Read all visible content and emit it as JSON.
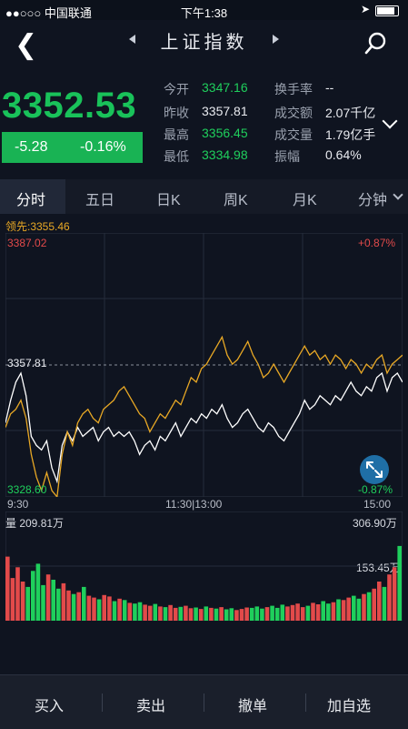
{
  "status_bar": {
    "carrier": "●●○○○ 中国联通",
    "time": "下午1:38",
    "arrow": "➤"
  },
  "header": {
    "title": "上证指数",
    "subtitle": ""
  },
  "quote": {
    "price": "3352.53",
    "change": "-5.28",
    "change_pct": "-0.16%",
    "stats": [
      {
        "label": "今开",
        "value": "3347.16",
        "color": "green"
      },
      {
        "label": "换手率",
        "value": "--",
        "color": "white"
      },
      {
        "label": "昨收",
        "value": "3357.81",
        "color": "white"
      },
      {
        "label": "成交额",
        "value": "2.07千亿",
        "color": "white"
      },
      {
        "label": "最高",
        "value": "3356.45",
        "color": "green"
      },
      {
        "label": "成交量",
        "value": "1.79亿手",
        "color": "white"
      },
      {
        "label": "最低",
        "value": "3334.98",
        "color": "green"
      },
      {
        "label": "振幅",
        "value": "0.64%",
        "color": "white"
      }
    ]
  },
  "tabs": [
    "分时",
    "五日",
    "日K",
    "周K",
    "月K",
    "分钟"
  ],
  "chart": {
    "lead_label": "领先:3355.46",
    "y_top": "3387.02",
    "y_top_pct": "+0.87%",
    "y_mid": "3357.81",
    "y_bottom": "3328.60",
    "y_bottom_pct": "-0.87%",
    "t_start": "9:30",
    "t_mid": "11:30|13:00",
    "t_end": "15:00",
    "vol_label": "量 209.81万",
    "vol_max": "306.90万",
    "vol_mid": "153.45万"
  },
  "chart_data": {
    "type": "line",
    "y_range": [
      3328.6,
      3387.02
    ],
    "prev_close": 3357.81,
    "series": [
      {
        "color": "#ffffff",
        "values": [
          3345,
          3350,
          3354,
          3356,
          3351,
          3342,
          3340,
          3339,
          3341,
          3335,
          3332,
          3340,
          3343,
          3341,
          3344,
          3342,
          3343,
          3344,
          3341,
          3343,
          3344,
          3342,
          3343,
          3342,
          3343,
          3341,
          3338,
          3340,
          3341,
          3339,
          3342,
          3341,
          3343,
          3345,
          3342,
          3344,
          3346,
          3345,
          3347,
          3346,
          3348,
          3347,
          3349,
          3346,
          3344,
          3345,
          3347,
          3348,
          3346,
          3344,
          3343,
          3345,
          3344,
          3342,
          3341,
          3343,
          3345,
          3347,
          3350,
          3348,
          3349,
          3351,
          3350,
          3349,
          3351,
          3350,
          3352,
          3354,
          3352,
          3351,
          3353,
          3352,
          3355,
          3356,
          3352,
          3355,
          3356,
          3354
        ]
      },
      {
        "color": "#e8a825",
        "values": [
          3344,
          3347,
          3348,
          3350,
          3346,
          3338,
          3333,
          3330,
          3334,
          3330,
          3328.6,
          3338,
          3343,
          3340,
          3345,
          3347,
          3348,
          3346,
          3345,
          3348,
          3349,
          3350,
          3352,
          3353,
          3351,
          3349,
          3347,
          3346,
          3343,
          3345,
          3347,
          3346,
          3348,
          3350,
          3349,
          3352,
          3355,
          3354,
          3357,
          3358,
          3360,
          3362,
          3364,
          3360,
          3358,
          3359,
          3361,
          3363,
          3360,
          3358,
          3355,
          3356,
          3358,
          3356,
          3354,
          3356,
          3358,
          3360,
          3362,
          3360,
          3361,
          3359,
          3360,
          3358,
          3360,
          3359,
          3357,
          3359,
          3358,
          3356,
          3358,
          3357,
          3359,
          3360,
          3356,
          3358,
          3359,
          3360
        ]
      }
    ],
    "volume_range": [
      0,
      306.9
    ],
    "volume": [
      180,
      120,
      150,
      110,
      95,
      140,
      160,
      100,
      130,
      115,
      90,
      105,
      85,
      75,
      80,
      95,
      70,
      65,
      60,
      72,
      68,
      55,
      62,
      58,
      50,
      48,
      52,
      45,
      42,
      47,
      40,
      38,
      44,
      36,
      39,
      42,
      35,
      37,
      33,
      40,
      36,
      34,
      38,
      32,
      35,
      30,
      33,
      37,
      36,
      40,
      34,
      38,
      42,
      36,
      45,
      40,
      44,
      48,
      38,
      42,
      50,
      46,
      55,
      48,
      52,
      60,
      58,
      65,
      70,
      62,
      75,
      80,
      90,
      110,
      95,
      130,
      150,
      210
    ]
  },
  "bottom_bar": [
    "买入",
    "卖出",
    "撤单",
    "加自选"
  ],
  "colors": {
    "green": "#1fcf5c",
    "red": "#e24a4a",
    "orange": "#e8a825"
  }
}
